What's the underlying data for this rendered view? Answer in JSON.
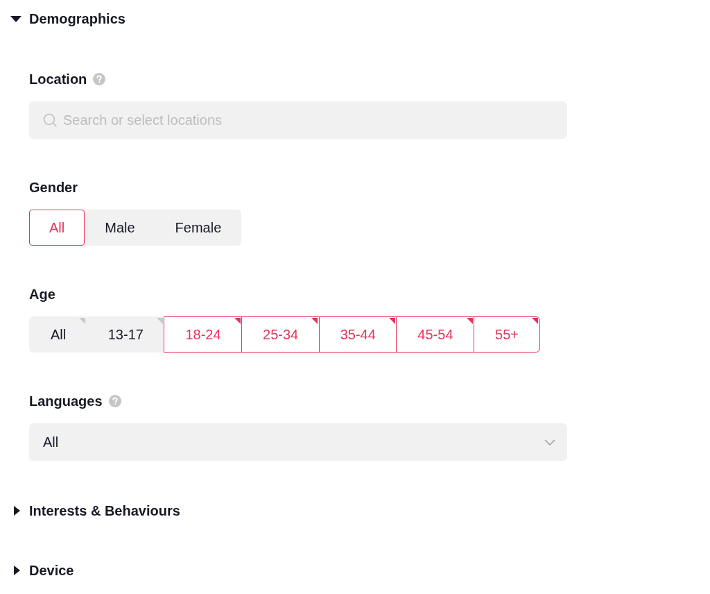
{
  "sections": [
    {
      "title": "Demographics",
      "expanded": true,
      "fields": [
        {
          "kind": "search",
          "label": "Location",
          "help": true,
          "placeholder": "Search or select locations"
        },
        {
          "kind": "segmented",
          "label": "Gender",
          "help": false,
          "options": [
            {
              "label": "All",
              "selected": true
            },
            {
              "label": "Male",
              "selected": false
            },
            {
              "label": "Female",
              "selected": false
            }
          ]
        },
        {
          "kind": "multi",
          "label": "Age",
          "help": false,
          "options": [
            {
              "label": "All",
              "selected": false
            },
            {
              "label": "13-17",
              "selected": false
            },
            {
              "label": "18-24",
              "selected": true
            },
            {
              "label": "25-34",
              "selected": true
            },
            {
              "label": "35-44",
              "selected": true
            },
            {
              "label": "45-54",
              "selected": true
            },
            {
              "label": "55+",
              "selected": true
            }
          ]
        },
        {
          "kind": "select",
          "label": "Languages",
          "help": true,
          "value": "All"
        }
      ]
    },
    {
      "title": "Interests & Behaviours",
      "expanded": false
    },
    {
      "title": "Device",
      "expanded": false
    }
  ]
}
